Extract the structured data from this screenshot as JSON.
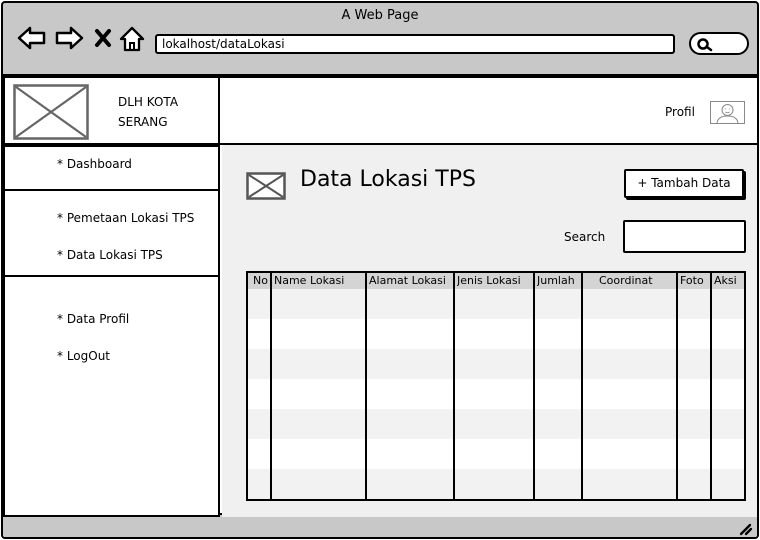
{
  "browser": {
    "title": "A Web Page",
    "url": "lokalhost/dataLokasi",
    "icons": [
      "back-arrow-icon",
      "forward-arrow-icon",
      "close-x-icon",
      "home-icon",
      "search-icon"
    ]
  },
  "brand": {
    "name": "DLH KOTA SERANG"
  },
  "header": {
    "profile_label": "Profil"
  },
  "sidebar": {
    "sections": [
      {
        "items": [
          {
            "label": "* Dashboard"
          }
        ]
      },
      {
        "items": [
          {
            "label": "* Pemetaan Lokasi TPS"
          },
          {
            "label": "* Data Lokasi TPS"
          }
        ]
      },
      {
        "items": [
          {
            "label": "* Data Profil"
          },
          {
            "label": "* LogOut"
          }
        ]
      }
    ]
  },
  "main": {
    "title": "Data Lokasi TPS",
    "add_button": "+ Tambah Data",
    "search_label": "Search",
    "search_value": ""
  },
  "table": {
    "columns": [
      "No",
      "Name Lokasi",
      "Alamat Lokasi",
      "Jenis Lokasi",
      "Jumlah",
      "Coordinat",
      "Foto",
      "Aksi"
    ],
    "rows": []
  }
}
